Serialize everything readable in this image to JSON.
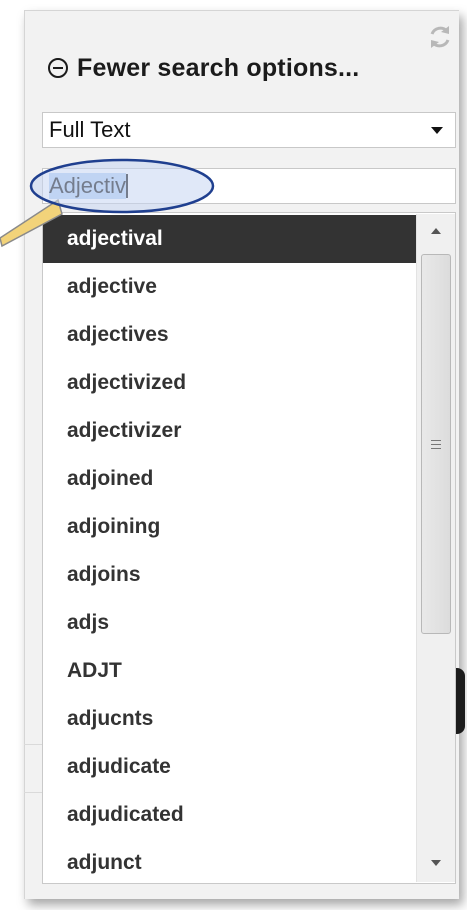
{
  "panel": {
    "toggle_label": "Fewer search options...",
    "toggle_icon": "circle-minus-icon",
    "refresh_icon": "refresh-icon"
  },
  "search_field_select": {
    "value": "Full Text"
  },
  "search_input": {
    "value": "Adjectiv",
    "selected_text": "Adjectiv"
  },
  "autocomplete": {
    "active_index": 0,
    "items": [
      "adjectival",
      "adjective",
      "adjectives",
      "adjectivized",
      "adjectivizer",
      "adjoined",
      "adjoining",
      "adjoins",
      "adjs",
      "ADJT",
      "adjucnts",
      "adjudicate",
      "adjudicated",
      "adjunct"
    ]
  },
  "colors": {
    "active_item_bg": "#333333",
    "active_item_text": "#ffffff",
    "annotation_fill": "#c7d6f2",
    "annotation_stroke": "#1f3f8f",
    "pointer_fill": "#f2d37a"
  }
}
